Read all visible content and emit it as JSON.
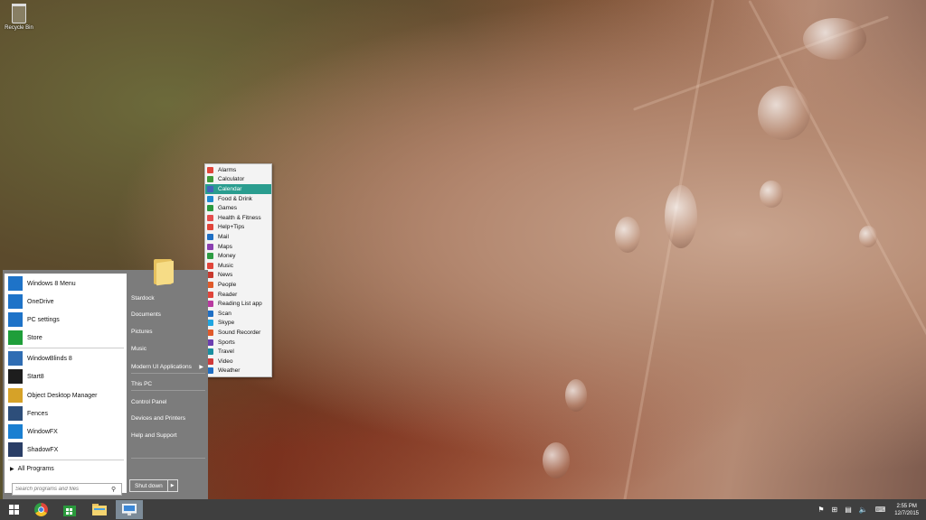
{
  "desktop": {
    "recycle_bin_label": "Recycle Bin"
  },
  "start_menu": {
    "pinned": [
      {
        "label": "Windows 8 Menu",
        "icon": "windows-8-menu-icon",
        "color": "#1e73c8"
      },
      {
        "label": "OneDrive",
        "icon": "onedrive-icon",
        "color": "#1e73c8"
      },
      {
        "label": "PC settings",
        "icon": "gear-icon",
        "color": "#1e73c8"
      },
      {
        "label": "Store",
        "icon": "store-icon",
        "color": "#1f9e3a"
      },
      {
        "label": "WindowBlinds 8",
        "icon": "windowblinds-icon",
        "color": "#2f6db3"
      },
      {
        "label": "Start8",
        "icon": "start8-icon",
        "color": "#1d1d1d"
      },
      {
        "label": "Object Desktop Manager",
        "icon": "object-desktop-icon",
        "color": "#d6a228"
      },
      {
        "label": "Fences",
        "icon": "fences-icon",
        "color": "#2d4e7a"
      },
      {
        "label": "WindowFX",
        "icon": "windowfx-icon",
        "color": "#1a7fd1"
      },
      {
        "label": "ShadowFX",
        "icon": "shadowfx-icon",
        "color": "#2a3e66"
      }
    ],
    "all_programs_label": "All Programs",
    "search_placeholder": "Search programs and files",
    "right_items": [
      {
        "label": "Stardock"
      },
      {
        "label": "Documents"
      },
      {
        "label": "Pictures"
      },
      {
        "label": "Music"
      },
      {
        "label": "Modern UI Applications"
      },
      {
        "label": "This PC"
      },
      {
        "label": "Control Panel"
      },
      {
        "label": "Devices and Printers"
      },
      {
        "label": "Help and Support"
      }
    ],
    "shutdown_label": "Shut down"
  },
  "submenu": {
    "active_index": 2,
    "active_color": "#2a9d8f",
    "items": [
      {
        "label": "Alarms",
        "color": "#e0453a"
      },
      {
        "label": "Calculator",
        "color": "#3f9a3a"
      },
      {
        "label": "Calendar",
        "color": "#4263b8"
      },
      {
        "label": "Food & Drink",
        "color": "#1f8ad0"
      },
      {
        "label": "Games",
        "color": "#2b9a3f"
      },
      {
        "label": "Health & Fitness",
        "color": "#e44d4d"
      },
      {
        "label": "Help+Tips",
        "color": "#e0453a"
      },
      {
        "label": "Mail",
        "color": "#1f6fc4"
      },
      {
        "label": "Maps",
        "color": "#8a3fb0"
      },
      {
        "label": "Money",
        "color": "#2d9c43"
      },
      {
        "label": "Music",
        "color": "#e0453a"
      },
      {
        "label": "News",
        "color": "#c8392e"
      },
      {
        "label": "People",
        "color": "#e05a2a"
      },
      {
        "label": "Reader",
        "color": "#e0453a"
      },
      {
        "label": "Reading List app",
        "color": "#b83aa0"
      },
      {
        "label": "Scan",
        "color": "#1f6fc4"
      },
      {
        "label": "Skype",
        "color": "#1fa5e0"
      },
      {
        "label": "Sound Recorder",
        "color": "#e05a2a"
      },
      {
        "label": "Sports",
        "color": "#6c3fb0"
      },
      {
        "label": "Travel",
        "color": "#1b8fa0"
      },
      {
        "label": "Video",
        "color": "#d03a3a"
      },
      {
        "label": "Weather",
        "color": "#1f6fc4"
      }
    ]
  },
  "taskbar": {
    "apps": [
      {
        "name": "start-button",
        "icon": "windows-logo-icon"
      },
      {
        "name": "chrome-button",
        "icon": "chrome-icon"
      },
      {
        "name": "store-button",
        "icon": "store-icon"
      },
      {
        "name": "file-explorer-button",
        "icon": "folder-icon"
      },
      {
        "name": "control-panel-button",
        "icon": "monitor-icon"
      }
    ],
    "clock_time": "2:55 PM",
    "clock_date": "12/7/2015"
  }
}
